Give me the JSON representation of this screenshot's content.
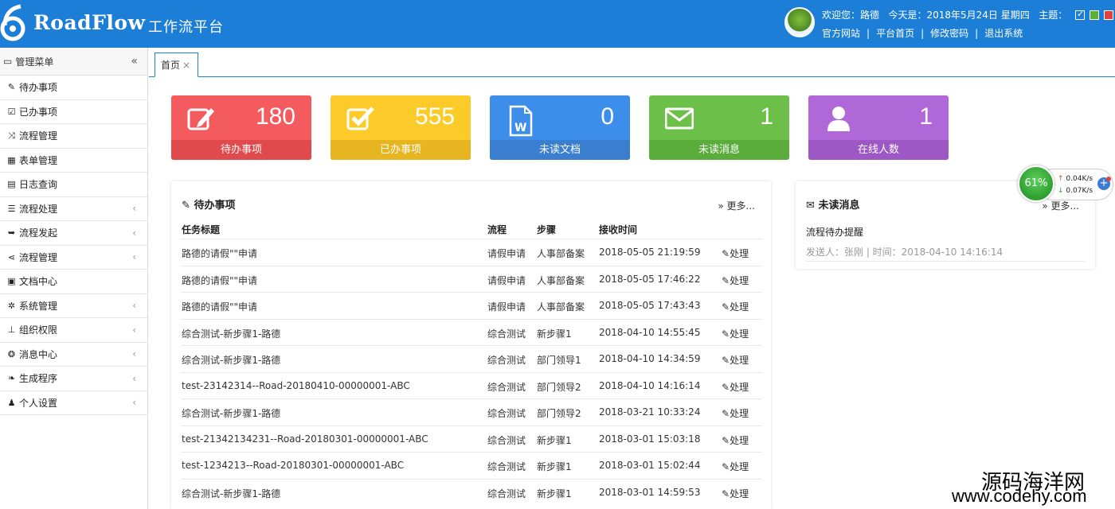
{
  "header": {
    "logo_text": "RoadFlow",
    "logo_sub": "工作流平台",
    "welcome": "欢迎您：路德",
    "today": "今天是：2018年5月24日 星期四",
    "theme_label": "主题：",
    "links": [
      "官方网站",
      "平台首页",
      "修改密码",
      "退出系统"
    ],
    "link_sep": "|"
  },
  "sidebar": {
    "title": "管理菜单",
    "collapse": "«",
    "items": [
      {
        "label": "待办事项",
        "icon": "edit-icon",
        "glyph": "✎",
        "arrow": false
      },
      {
        "label": "已办事项",
        "icon": "check-square-icon",
        "glyph": "☑",
        "arrow": false
      },
      {
        "label": "流程管理",
        "icon": "random-icon",
        "glyph": "⤨",
        "arrow": false
      },
      {
        "label": "表单管理",
        "icon": "table-icon",
        "glyph": "▦",
        "arrow": false
      },
      {
        "label": "日志查询",
        "icon": "file-icon",
        "glyph": "▤",
        "arrow": false
      },
      {
        "label": "流程处理",
        "icon": "list-icon",
        "glyph": "☰",
        "arrow": true
      },
      {
        "label": "流程发起",
        "icon": "sign-out-icon",
        "glyph": "➥",
        "arrow": true
      },
      {
        "label": "流程管理",
        "icon": "share-icon",
        "glyph": "⋖",
        "arrow": true
      },
      {
        "label": "文档中心",
        "icon": "file-word-icon",
        "glyph": "▣",
        "arrow": false
      },
      {
        "label": "系统管理",
        "icon": "gear-icon",
        "glyph": "✲",
        "arrow": true
      },
      {
        "label": "组织权限",
        "icon": "sitemap-icon",
        "glyph": "⊥",
        "arrow": true
      },
      {
        "label": "消息中心",
        "icon": "wechat-icon",
        "glyph": "❂",
        "arrow": true
      },
      {
        "label": "生成程序",
        "icon": "leaf-icon",
        "glyph": "❧",
        "arrow": true
      },
      {
        "label": "个人设置",
        "icon": "user-icon",
        "glyph": "♟",
        "arrow": true
      }
    ],
    "arrow_glyph": "‹"
  },
  "tabs": {
    "home": "首页",
    "close": "×"
  },
  "cards": [
    {
      "value": "180",
      "label": "待办事项",
      "color": "#f35b5f",
      "bottom": "#e14a4d",
      "icon": "edit-icon"
    },
    {
      "value": "555",
      "label": "已办事项",
      "color": "#fccb2a",
      "bottom": "#e6b520",
      "icon": "check-square-icon"
    },
    {
      "value": "0",
      "label": "未读文档",
      "color": "#3d8eea",
      "bottom": "#3a7ed0",
      "icon": "file-word-icon"
    },
    {
      "value": "1",
      "label": "未读消息",
      "color": "#6cc04a",
      "bottom": "#5aad3a",
      "icon": "envelope-icon"
    },
    {
      "value": "1",
      "label": "在线人数",
      "color": "#b067d8",
      "bottom": "#9e58c6",
      "icon": "user-icon"
    }
  ],
  "todo": {
    "title": "待办事项",
    "more": "» 更多...",
    "headers": {
      "title": "任务标题",
      "flow": "流程",
      "step": "步骤",
      "time": "接收时间"
    },
    "action": "处理",
    "rows": [
      {
        "title": "路德的请假\"\"申请",
        "flow": "请假申请",
        "step": "人事部备案",
        "time": "2018-05-05 21:19:59"
      },
      {
        "title": "路德的请假\"\"申请",
        "flow": "请假申请",
        "step": "人事部备案",
        "time": "2018-05-05 17:46:22"
      },
      {
        "title": "路德的请假\"\"申请",
        "flow": "请假申请",
        "step": "人事部备案",
        "time": "2018-05-05 17:43:43"
      },
      {
        "title": "综合测试-新步骤1-路德",
        "flow": "综合测试",
        "step": "新步骤1",
        "time": "2018-04-10 14:55:45"
      },
      {
        "title": "综合测试-新步骤1-路德",
        "flow": "综合测试",
        "step": "部门领导1",
        "time": "2018-04-10 14:34:59"
      },
      {
        "title": "test-23142314--Road-20180410-00000001-ABC",
        "flow": "综合测试",
        "step": "部门领导2",
        "time": "2018-04-10 14:16:14"
      },
      {
        "title": "综合测试-新步骤1-路德",
        "flow": "综合测试",
        "step": "部门领导2",
        "time": "2018-03-21 10:33:24"
      },
      {
        "title": "test-21342134231--Road-20180301-00000001-ABC",
        "flow": "综合测试",
        "step": "新步骤1",
        "time": "2018-03-01 15:03:18"
      },
      {
        "title": "test-1234213--Road-20180301-00000001-ABC",
        "flow": "综合测试",
        "step": "新步骤1",
        "time": "2018-03-01 15:02:44"
      },
      {
        "title": "综合测试-新步骤1-路德",
        "flow": "综合测试",
        "step": "新步骤1",
        "time": "2018-03-01 14:59:53"
      }
    ]
  },
  "messages": {
    "title": "未读消息",
    "more": "» 更多...",
    "item_title": "流程待办提醒",
    "item_meta": "发送人：张刚 | 时间：2018-04-10 14:16:14"
  },
  "widget": {
    "percent": "61%",
    "up": "0.04K/s",
    "down": "0.07K/s"
  },
  "watermark": {
    "line1": "源码海洋网",
    "line2": "www.codehy.com"
  }
}
